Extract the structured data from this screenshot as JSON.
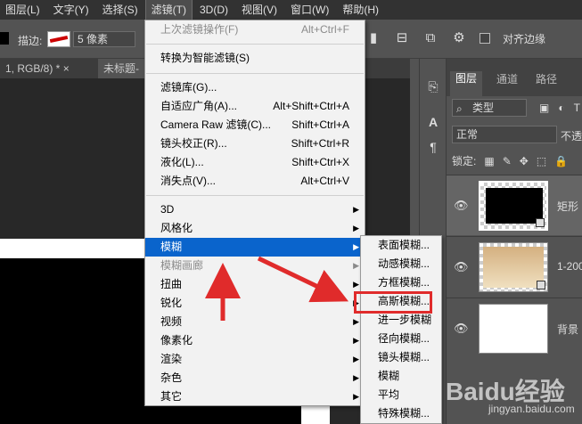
{
  "menubar": {
    "items": [
      "图层(L)",
      "文字(Y)",
      "选择(S)",
      "滤镜(T)",
      "3D(D)",
      "视图(V)",
      "窗口(W)",
      "帮助(H)"
    ]
  },
  "options": {
    "stroke_label": "描边:",
    "stroke_width": "5 像素",
    "align_edges": "对齐边缘"
  },
  "doc_tabs": {
    "tab1": "1, RGB/8) *",
    "tab1_close": "×",
    "tab2": "未标题-"
  },
  "filter_menu": {
    "last_filter": {
      "label": "上次滤镜操作(F)",
      "shortcut": "Alt+Ctrl+F"
    },
    "convert_smart": "转换为智能滤镜(S)",
    "items": [
      {
        "label": "滤镜库(G)...",
        "shortcut": ""
      },
      {
        "label": "自适应广角(A)...",
        "shortcut": "Alt+Shift+Ctrl+A"
      },
      {
        "label": "Camera Raw 滤镜(C)...",
        "shortcut": "Shift+Ctrl+A"
      },
      {
        "label": "镜头校正(R)...",
        "shortcut": "Shift+Ctrl+R"
      },
      {
        "label": "液化(L)...",
        "shortcut": "Shift+Ctrl+X"
      },
      {
        "label": "消失点(V)...",
        "shortcut": "Alt+Ctrl+V"
      }
    ],
    "submenus": [
      "3D",
      "风格化",
      "模糊",
      "模糊画廊",
      "扭曲",
      "锐化",
      "视频",
      "像素化",
      "渲染",
      "杂色",
      "其它"
    ]
  },
  "blur_submenu": {
    "items": [
      "表面模糊...",
      "动感模糊...",
      "方框模糊...",
      "高斯模糊...",
      "进一步模糊",
      "径向模糊...",
      "镜头模糊...",
      "模糊",
      "平均",
      "特殊模糊..."
    ]
  },
  "layers_panel": {
    "tabs": [
      "图层",
      "通道",
      "路径"
    ],
    "filter_kind": "类型",
    "blend_mode": "正常",
    "opacity_label": "不透",
    "lock_label": "锁定:",
    "layers": [
      {
        "name": "矩形"
      },
      {
        "name": "1-200"
      },
      {
        "name": "背景"
      }
    ]
  },
  "watermark": {
    "brand": "Baidu经验",
    "url": "jingyan.baidu.com"
  },
  "colors": {
    "highlight": "#0a64cc",
    "annotation": "#e02b2b"
  }
}
